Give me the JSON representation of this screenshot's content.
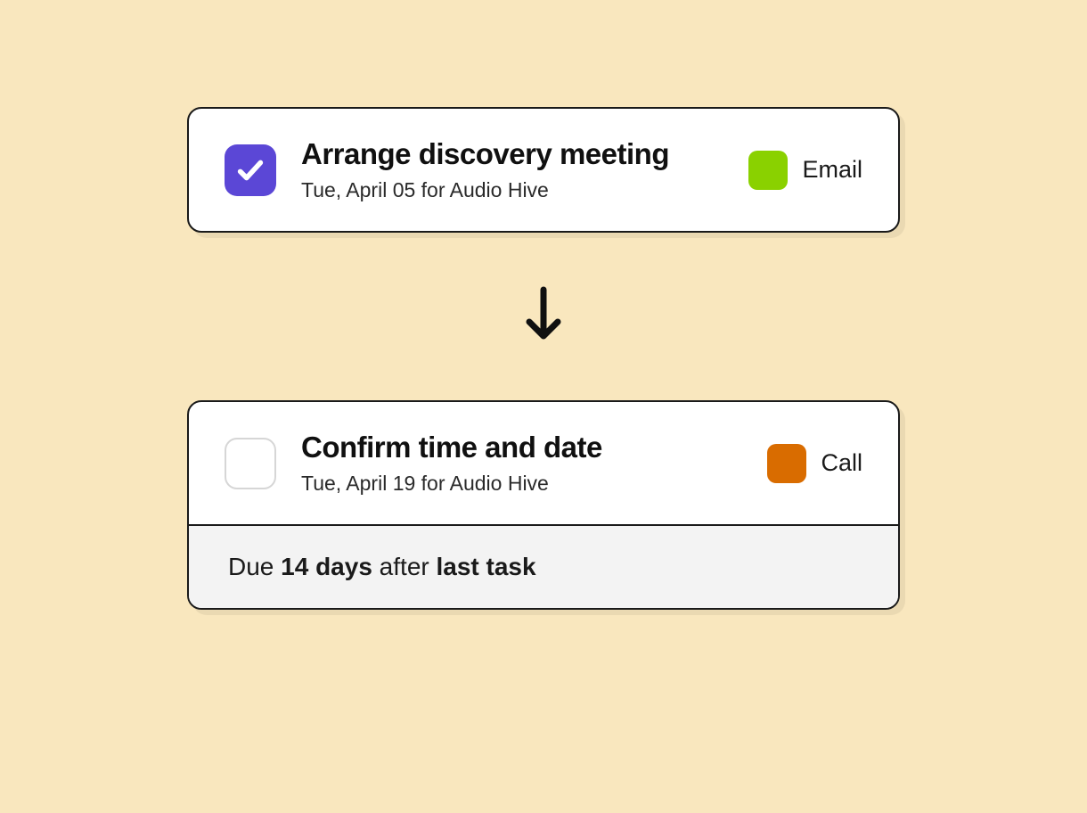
{
  "colors": {
    "checked_bg": "#5b47d6",
    "tag1": "#8ad100",
    "tag2": "#d96c00"
  },
  "task1": {
    "title": "Arrange discovery meeting",
    "subtitle": "Tue, April 05 for Audio Hive",
    "tag_label": "Email"
  },
  "task2": {
    "title": "Confirm time and date",
    "subtitle": "Tue, April 19 for Audio Hive",
    "tag_label": "Call"
  },
  "due_rule": {
    "prefix": "Due ",
    "strong1": "14 days",
    "mid": " after ",
    "strong2": "last task"
  }
}
